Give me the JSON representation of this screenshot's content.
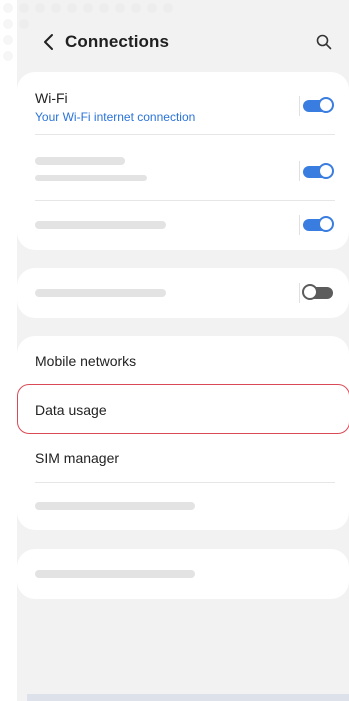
{
  "header": {
    "title": "Connections",
    "back_icon": "chevron-left-icon",
    "search_icon": "search-icon"
  },
  "wifi": {
    "label": "Wi-Fi",
    "sublabel": "Your Wi-Fi internet connection",
    "toggle_on": true
  },
  "menu": {
    "mobile_networks": "Mobile networks",
    "data_usage": "Data usage",
    "sim_manager": "SIM manager"
  },
  "colors": {
    "accent": "#3a7de0",
    "sublabel": "#2a73d9",
    "highlight_border": "#d94a57",
    "background": "#f2f2f2"
  }
}
